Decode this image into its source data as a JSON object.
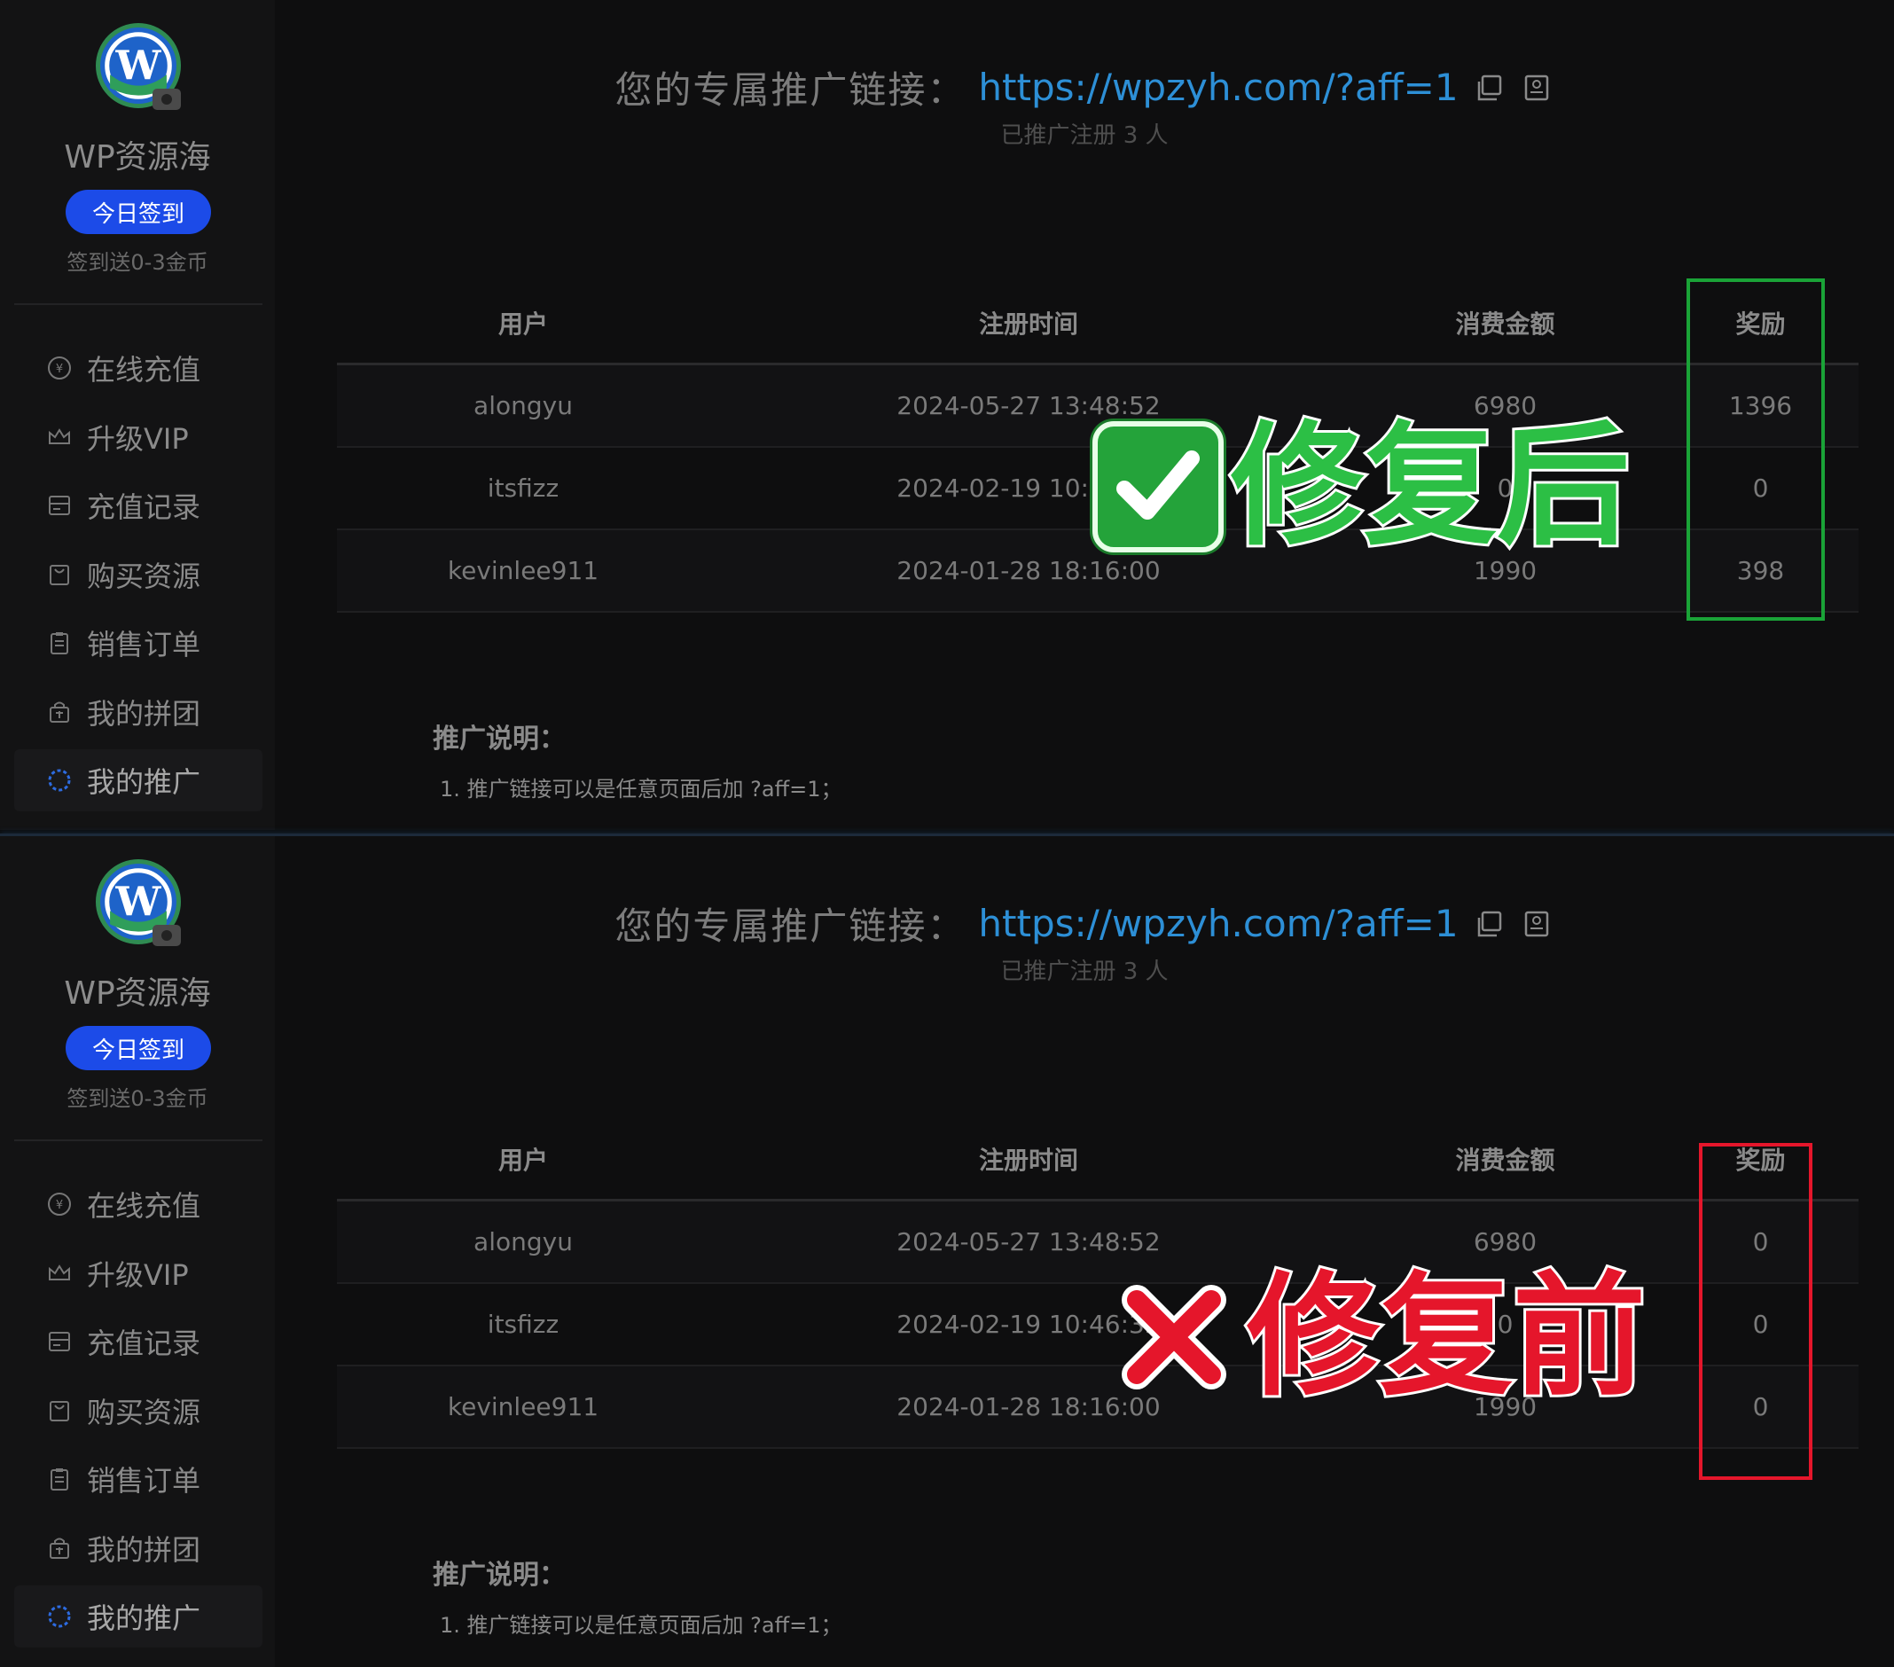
{
  "sidebar": {
    "site_name": "WP资源海",
    "checkin_label": "今日签到",
    "checkin_sub": "签到送0-3金币",
    "menu": [
      {
        "label": "在线充值",
        "icon": "yen-circle-icon"
      },
      {
        "label": "升级VIP",
        "icon": "crown-icon"
      },
      {
        "label": "充值记录",
        "icon": "wallet-icon"
      },
      {
        "label": "购买资源",
        "icon": "bag-icon"
      },
      {
        "label": "销售订单",
        "icon": "clipboard-icon"
      },
      {
        "label": "我的拼团",
        "icon": "group-buy-icon"
      },
      {
        "label": "我的推广",
        "icon": "promo-spinner-icon",
        "active": true
      }
    ]
  },
  "promo": {
    "label": "您的专属推广链接：",
    "url": "https://wpzyh.com/?aff=1",
    "registered": "已推广注册 3 人"
  },
  "table": {
    "headers": [
      "用户",
      "注册时间",
      "消费金额",
      "奖励"
    ]
  },
  "after": {
    "badge": "修复后",
    "rows": [
      [
        "alongyu",
        "2024-05-27 13:48:52",
        "6980",
        "1396"
      ],
      [
        "itsfizz",
        "2024-02-19 10:46:33",
        "0",
        "0"
      ],
      [
        "kevinlee911",
        "2024-01-28 18:16:00",
        "1990",
        "398"
      ]
    ]
  },
  "before": {
    "badge": "修复前",
    "rows": [
      [
        "alongyu",
        "2024-05-27 13:48:52",
        "6980",
        "0"
      ],
      [
        "itsfizz",
        "2024-02-19 10:46:33",
        "0",
        "0"
      ],
      [
        "kevinlee911",
        "2024-01-28 18:16:00",
        "1990",
        "0"
      ]
    ]
  },
  "notes": {
    "title": "推广说明：",
    "item1": "1. 推广链接可以是任意页面后加 ?aff=1；"
  },
  "colors": {
    "accent_link": "#2d8fd6",
    "checkin": "#1c4be8",
    "ok": "#1aa337",
    "bad": "#e5162b"
  }
}
